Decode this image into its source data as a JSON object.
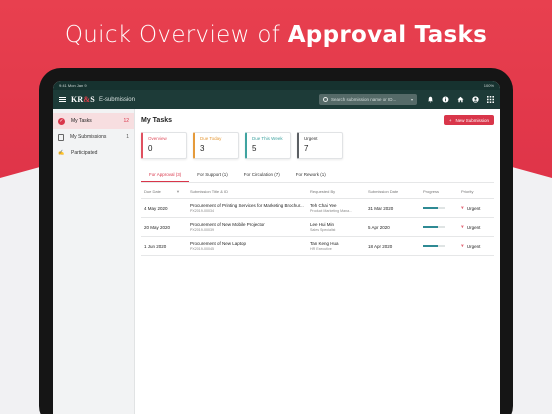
{
  "hero": {
    "title_regular": "Quick Overview of ",
    "title_bold": "Approval Tasks"
  },
  "status_bar": {
    "time": "9:41 Mon Jan 9",
    "battery": "100%"
  },
  "app": {
    "logo_main": "KR",
    "logo_accent": "&",
    "logo_end": "S",
    "name": "E-submission"
  },
  "search": {
    "placeholder": "Search submission name or ID...",
    "dropdown_icon": "chevron-down-icon"
  },
  "topbar_icons": [
    "bell-icon",
    "info-icon",
    "home-icon",
    "user-icon",
    "grid-icon"
  ],
  "sidebar": {
    "items": [
      {
        "label": "My Tasks",
        "count": "12",
        "icon": "check-circle-icon"
      },
      {
        "label": "My Submissions",
        "count": "1",
        "icon": "document-icon"
      },
      {
        "label": "Participated",
        "count": "",
        "icon": "signature-icon"
      }
    ]
  },
  "main": {
    "title": "My Tasks",
    "new_button": "New Submission"
  },
  "cards": [
    {
      "label": "Overview",
      "value": "0",
      "color": "#e0505f"
    },
    {
      "label": "Due Today",
      "value": "3",
      "color": "#e59a3a"
    },
    {
      "label": "Due This Week",
      "value": "5",
      "color": "#3fa3a0"
    },
    {
      "label": "Urgent",
      "value": "7",
      "color": "#5b5f63"
    }
  ],
  "tabs": [
    "For Approval (3)",
    "For Support (1)",
    "For Circulation (7)",
    "For Rework (1)"
  ],
  "table": {
    "headers": [
      "Due Date",
      "Submission Title & ID",
      "Requested By",
      "Submission Date",
      "Progress",
      "Priority"
    ],
    "rows": [
      {
        "due": "4 May 2020",
        "title": "Procurement of Printing Services for Marketing Brochur...",
        "id": "PX2019-00034",
        "requester": "Teh Chai Yee",
        "role": "Product Marketing Mana...",
        "submitted": "31 Mar 2020",
        "progress": 0.7,
        "priority": "Urgent"
      },
      {
        "due": "20 May 2020",
        "title": "Procurement of New Mobile Projector",
        "id": "PX2019-00039",
        "requester": "Lee Hui Min",
        "role": "Sales Specialist",
        "submitted": "5 Apr 2020",
        "progress": 0.7,
        "priority": "Urgent"
      },
      {
        "due": "1 Jun 2020",
        "title": "Procurement of New Laptop",
        "id": "PX2019-00045",
        "requester": "Tan Keng Hua",
        "role": "HR Executive",
        "submitted": "18 Apr 2020",
        "progress": 0.7,
        "priority": "Urgent"
      }
    ]
  }
}
